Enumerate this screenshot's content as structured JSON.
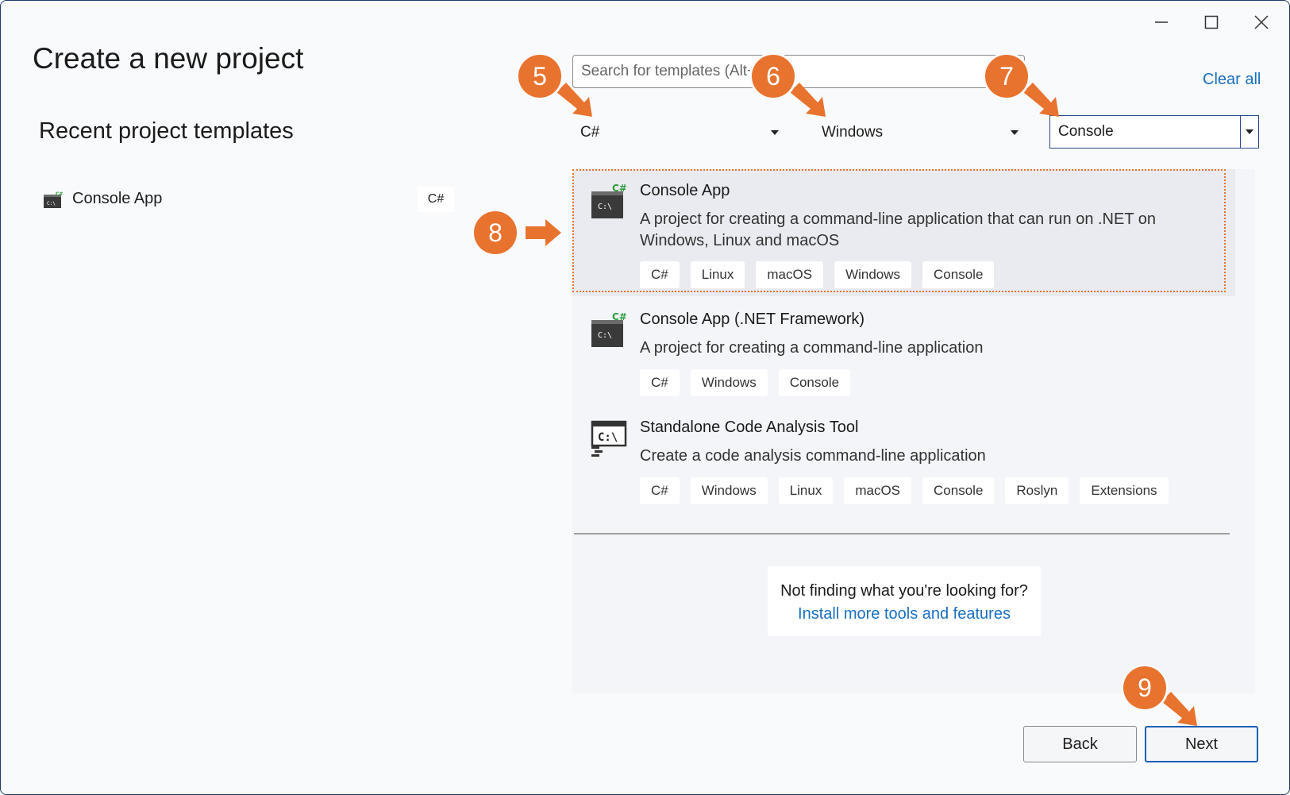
{
  "window": {
    "controls": {
      "minimize": "minimize",
      "maximize": "maximize",
      "close": "close"
    }
  },
  "page": {
    "title": "Create a new project"
  },
  "recent": {
    "heading": "Recent project templates",
    "items": [
      {
        "label": "Console App",
        "lang": "C#"
      }
    ]
  },
  "search": {
    "placeholder": "Search for templates (Alt+S)",
    "value": ""
  },
  "clear_all": "Clear all",
  "filters": {
    "language": "C#",
    "platform": "Windows",
    "project_type": "Console"
  },
  "templates": [
    {
      "name": "Console App",
      "description": "A project for creating a command-line application that can run on .NET on Windows, Linux and macOS",
      "tags": [
        "C#",
        "Linux",
        "macOS",
        "Windows",
        "Console"
      ],
      "icon": "console-app-icon"
    },
    {
      "name": "Console App (.NET Framework)",
      "description": "A project for creating a command-line application",
      "tags": [
        "C#",
        "Windows",
        "Console"
      ],
      "icon": "console-app-icon"
    },
    {
      "name": "Standalone Code Analysis Tool",
      "description": "Create a code analysis command-line application",
      "tags": [
        "C#",
        "Windows",
        "Linux",
        "macOS",
        "Console",
        "Roslyn",
        "Extensions"
      ],
      "icon": "code-analysis-icon"
    }
  ],
  "not_finding": {
    "question": "Not finding what you're looking for?",
    "link": "Install more tools and features"
  },
  "buttons": {
    "back": "Back",
    "next": "Next"
  },
  "callouts": [
    "5",
    "6",
    "7",
    "8",
    "9"
  ],
  "colors": {
    "accent": "#e8732e",
    "link": "#1a6fc0",
    "next_border": "#1a5fb4"
  }
}
